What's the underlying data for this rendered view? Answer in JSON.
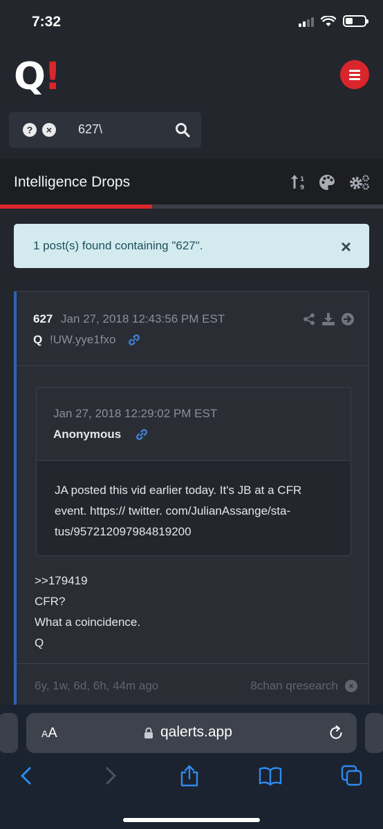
{
  "status_bar": {
    "time": "7:32"
  },
  "header": {
    "logo_q": "Q",
    "logo_bang": "!"
  },
  "search": {
    "query": "627\\"
  },
  "title_bar": {
    "title": "Intelligence Drops"
  },
  "alert": {
    "message": "1 post(s) found containing \"627\".",
    "close": "×"
  },
  "post": {
    "number": "627",
    "date": "Jan 27, 2018 12:43:56 PM EST",
    "author": "Q",
    "tripcode": "!UW.yye1fxo",
    "quote": {
      "date": "Jan 27, 2018 12:29:02 PM EST",
      "author": "Anonymous",
      "lines": [
        "JA posted this vid earlier today. It's JB at a CFR",
        "event. https:// twitter. com/JulianAssange/sta-",
        "tus/957212097984819200"
      ]
    },
    "body_lines": [
      ">>179419",
      "CFR?",
      "What a coincidence.",
      "Q"
    ],
    "age": "6y, 1w, 6d, 6h, 44m ago",
    "source": "8chan qresearch"
  },
  "safari": {
    "aa_small": "A",
    "aa_large": "A",
    "url": "qalerts.app"
  },
  "icons": {
    "help": "question-circle-icon",
    "clear": "times-circle-icon",
    "search": "search-icon",
    "sort": "sort-numeric-icon",
    "theme": "palette-icon",
    "settings": "cogs-icon"
  },
  "colors": {
    "accent": "#d9262c",
    "link": "#2e63b4",
    "alert_bg": "#d3ebef"
  }
}
